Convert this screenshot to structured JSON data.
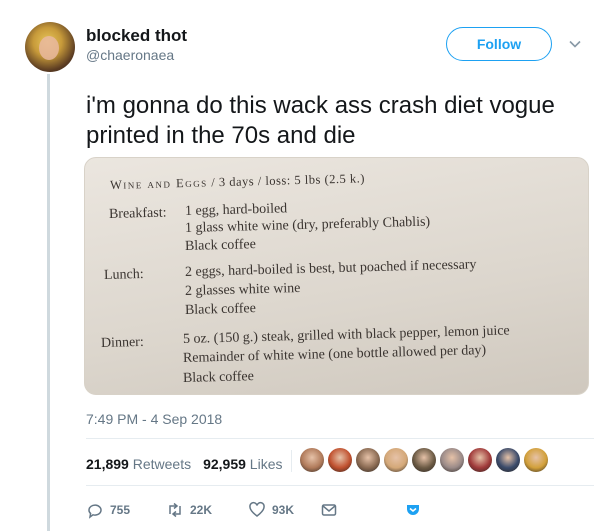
{
  "user": {
    "name": "blocked thot",
    "handle": "@chaeronaea",
    "follow_label": "Follow"
  },
  "tweet": {
    "text": "i'm gonna do this wack ass crash diet vogue printed in the 70s and die",
    "timestamp": "7:49 PM - 4 Sep 2018"
  },
  "photo": {
    "title_caps": "Wine and Eggs",
    "title_rest": " / 3 days / loss: 5 lbs (2.5 k.)",
    "meals": [
      {
        "label": "Breakfast:",
        "lines": [
          "1 egg, hard-boiled",
          "1 glass white wine (dry, preferably Chablis)",
          "Black coffee"
        ]
      },
      {
        "label": "Lunch:",
        "lines": [
          "2 eggs, hard-boiled is best, but poached if necessary",
          "2 glasses white wine",
          "Black coffee"
        ]
      },
      {
        "label": "Dinner:",
        "lines": [
          "5 oz. (150 g.) steak, grilled with black pepper, lemon juice",
          "Remainder of white wine (one bottle allowed per day)",
          "Black coffee"
        ]
      }
    ]
  },
  "stats": {
    "retweets_count": "21,899",
    "retweets_label": "Retweets",
    "likes_count": "92,959",
    "likes_label": "Likes",
    "avatar_colors": [
      "#b07a5a",
      "#c0502e",
      "#8a6a52",
      "#d4a878",
      "#6b5a44",
      "#9a8a88",
      "#a03a3a",
      "#3a4a6a",
      "#d2a03a"
    ]
  },
  "actions": {
    "replies": "755",
    "retweets": "22K",
    "likes": "93K"
  },
  "colors": {
    "accent": "#1da1f2",
    "muted": "#657786"
  }
}
